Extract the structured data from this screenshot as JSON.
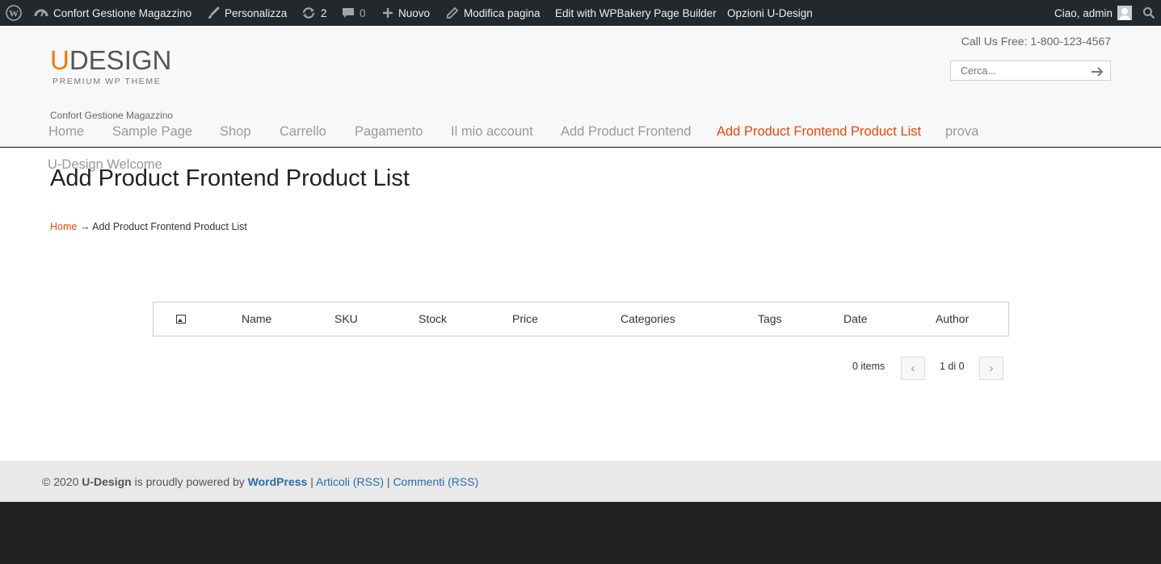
{
  "adminbar": {
    "site_name": "Confort Gestione Magazzino",
    "customize": "Personalizza",
    "updates_count": "2",
    "comments_count": "0",
    "new_label": "Nuovo",
    "edit_page": "Modifica pagina",
    "wpbakery": "Edit with WPBakery Page Builder",
    "udesign_options": "Opzioni U-Design",
    "greeting": "Ciao, admin"
  },
  "header": {
    "logo_u": "U",
    "logo_rest": "DESIGN",
    "logo_tagline": "PREMIUM WP THEME",
    "call_us": "Call Us Free: 1-800-123-4567",
    "search_placeholder": "Cerca...",
    "site_description": "Confort Gestione Magazzino"
  },
  "menu": {
    "items": [
      {
        "label": "Home"
      },
      {
        "label": "Sample Page"
      },
      {
        "label": "Shop"
      },
      {
        "label": "Carrello"
      },
      {
        "label": "Pagamento"
      },
      {
        "label": "Il mio account"
      },
      {
        "label": "Add Product Frontend"
      },
      {
        "label": "Add Product Frontend Product List"
      },
      {
        "label": "prova"
      }
    ],
    "overflow_item": "U-Design Welcome",
    "active_index": 7
  },
  "page": {
    "title": "Add Product Frontend Product List",
    "breadcrumb_home": "Home",
    "breadcrumb_sep": "→",
    "breadcrumb_current": "Add Product Frontend Product List"
  },
  "table": {
    "columns": [
      "Name",
      "SKU",
      "Stock",
      "Price",
      "Categories",
      "Tags",
      "Date",
      "Author"
    ],
    "image_column_icon": "image-icon"
  },
  "pagination": {
    "items_text": "0 items",
    "prev": "‹",
    "pages_text": "1 di 0",
    "next": "›"
  },
  "footer": {
    "copyright": "© 2020",
    "brand": "U-Design",
    "powered_text": "is proudly powered by",
    "wordpress": "WordPress",
    "sep": "|",
    "articles_rss": "Articoli (RSS)",
    "comments_rss": "Commenti (RSS)"
  },
  "colors": {
    "accent": "#e8470b",
    "logo_accent": "#f07800",
    "link": "#2a6ca8",
    "adminbar_bg": "#23282d"
  }
}
